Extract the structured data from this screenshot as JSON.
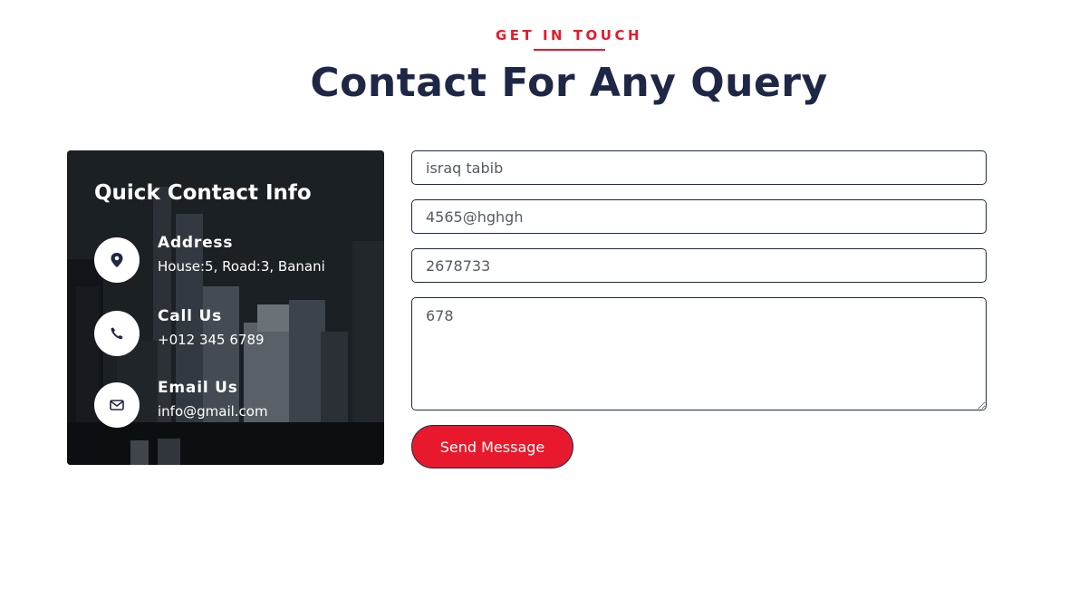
{
  "header": {
    "eyebrow": "GET IN TOUCH",
    "title": "Contact For Any Query"
  },
  "info_card": {
    "title": "Quick Contact Info",
    "items": [
      {
        "icon": "map-pin-icon",
        "label": "Address",
        "value": "House:5, Road:3, Banani"
      },
      {
        "icon": "phone-icon",
        "label": "Call Us",
        "value": "+012 345 6789"
      },
      {
        "icon": "envelope-icon",
        "label": "Email Us",
        "value": "info@gmail.com"
      }
    ]
  },
  "form": {
    "name_value": "israq tabib",
    "email_value": "4565@hghgh",
    "phone_value": "2678733",
    "message_value": "678",
    "submit_label": "Send Message"
  },
  "colors": {
    "accent": "#e8192c",
    "heading": "#1e2745",
    "card_background": "#1c2126"
  }
}
